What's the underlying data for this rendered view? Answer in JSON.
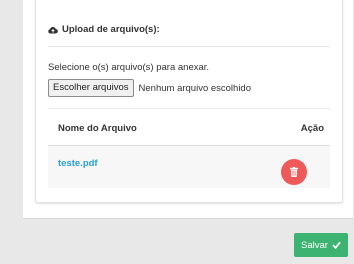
{
  "upload": {
    "header_icon": "cloud-upload-icon",
    "title": "Upload de arquivo(s):",
    "select_label": "Selecione o(s) arquivo(s) para anexar.",
    "choose_button": "Escolher arquivos",
    "no_file_text": "Nenhum arquivo escolhido"
  },
  "table": {
    "columns": [
      "Nome do Arquivo",
      "Ação"
    ],
    "rows": [
      {
        "file_name": "teste.pdf",
        "action_icon": "trash-icon"
      }
    ]
  },
  "actions": {
    "save_label": "Salvar",
    "save_icon": "check-icon"
  },
  "colors": {
    "link": "#2a9fd6",
    "delete": "#f0595a",
    "save": "#3cb371"
  }
}
